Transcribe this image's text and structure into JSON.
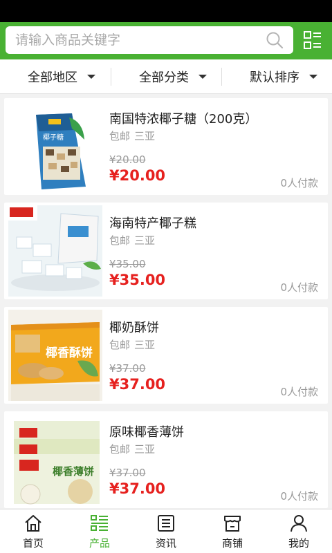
{
  "search": {
    "placeholder": "请输入商品关键字"
  },
  "filters": [
    {
      "label": "全部地区"
    },
    {
      "label": "全部分类"
    },
    {
      "label": "默认排序"
    }
  ],
  "products": [
    {
      "title": "南国特浓椰子糖（200克）",
      "shipping": "包邮",
      "city": "三亚",
      "old_price": "¥20.00",
      "price": "¥20.00",
      "sold": "0人付款"
    },
    {
      "title": "海南特产椰子糕",
      "shipping": "包邮",
      "city": "三亚",
      "old_price": "¥35.00",
      "price": "¥35.00",
      "sold": "0人付款"
    },
    {
      "title": "椰奶酥饼",
      "shipping": "包邮",
      "city": "三亚",
      "old_price": "¥37.00",
      "price": "¥37.00",
      "sold": "0人付款"
    },
    {
      "title": "原味椰香薄饼",
      "shipping": "包邮",
      "city": "三亚",
      "old_price": "¥37.00",
      "price": "¥37.00",
      "sold": "0人付款"
    }
  ],
  "tabs": [
    {
      "label": "首页",
      "icon": "home-icon"
    },
    {
      "label": "产品",
      "icon": "product-list-icon"
    },
    {
      "label": "资讯",
      "icon": "news-icon"
    },
    {
      "label": "商铺",
      "icon": "shop-icon"
    },
    {
      "label": "我的",
      "icon": "user-icon"
    }
  ],
  "colors": {
    "brand": "#49b133",
    "price": "#e6211f",
    "muted": "#999999"
  }
}
